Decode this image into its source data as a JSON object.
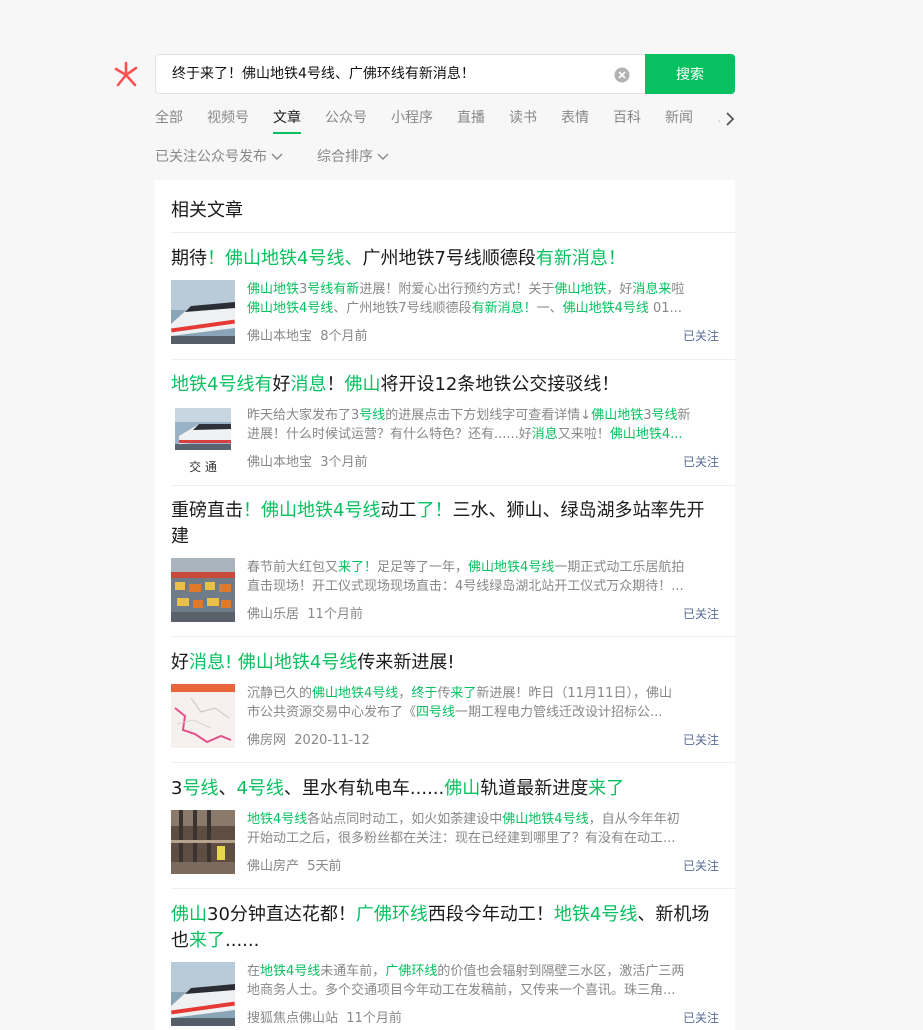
{
  "search": {
    "query": "终于来了！佛山地铁4号线、广佛环线有新消息！",
    "button": "搜索"
  },
  "tabs": [
    "全部",
    "视频号",
    "文章",
    "公众号",
    "小程序",
    "直播",
    "读书",
    "表情",
    "百科",
    "新闻",
    "…"
  ],
  "active_tab": "文章",
  "filters": {
    "source": "已关注公众号发布",
    "sort": "综合排序"
  },
  "section_title": "相关文章",
  "articles": [
    {
      "title": [
        [
          "期待",
          0
        ],
        [
          "！佛山地铁4号线",
          1
        ],
        [
          "、",
          1
        ],
        [
          "广州地铁7号线顺德段",
          0
        ],
        [
          "有新消息！",
          1
        ]
      ],
      "desc1": [
        [
          "佛山地铁",
          1
        ],
        [
          "3",
          0
        ],
        [
          "号线有新",
          1
        ],
        [
          "进展！附爱心出行预约方式！关于",
          0
        ],
        [
          "佛山地铁",
          1
        ],
        [
          "，好",
          0
        ],
        [
          "消息来",
          1
        ],
        [
          "啦",
          0
        ]
      ],
      "desc2": [
        [
          "佛山地铁4号线",
          1
        ],
        [
          "、广州地铁7号线顺德段",
          0
        ],
        [
          "有新消息！",
          1
        ],
        [
          "一、",
          0
        ],
        [
          "佛山地铁4号线",
          1
        ],
        [
          " 01...",
          0
        ]
      ],
      "source": "佛山本地宝",
      "time": "8个月前",
      "follow": "已关注"
    },
    {
      "title": [
        [
          "地铁4号线有",
          1
        ],
        [
          "好",
          0
        ],
        [
          "消息",
          1
        ],
        [
          "！",
          0
        ],
        [
          "佛山",
          1
        ],
        [
          "将开设12条地铁公交接驳线！",
          0
        ]
      ],
      "desc1": [
        [
          "昨天给大家发布了3",
          0
        ],
        [
          "号线",
          1
        ],
        [
          "的进展点击下方划线字可查看详情↓",
          0
        ],
        [
          "佛山地铁",
          1
        ],
        [
          "3",
          0
        ],
        [
          "号线",
          1
        ],
        [
          "新",
          0
        ]
      ],
      "desc2": [
        [
          "进展！什么时候试运营？有什么特色？还有......好",
          0
        ],
        [
          "消息",
          1
        ],
        [
          "又来啦！",
          0
        ],
        [
          "佛山地铁4...",
          1
        ]
      ],
      "source": "佛山本地宝",
      "time": "3个月前",
      "follow": "已关注",
      "thumb_caption": "交 通"
    },
    {
      "title": [
        [
          "重磅直击",
          0
        ],
        [
          "！佛山地铁4号线",
          1
        ],
        [
          "动工",
          0
        ],
        [
          "了！",
          1
        ],
        [
          "三水、狮山、绿岛湖多站率先开建",
          0
        ]
      ],
      "desc1": [
        [
          "春节前大红包又",
          0
        ],
        [
          "来了！",
          1
        ],
        [
          "足足等了一年，",
          0
        ],
        [
          "佛山地铁4号线",
          1
        ],
        [
          "一期正式动工乐居航拍",
          0
        ]
      ],
      "desc2": [
        [
          "直击现场！开工仪式现场现场直击：4号线绿岛湖北站开工仪式万众期待！...",
          0
        ]
      ],
      "source": "佛山乐居",
      "time": "11个月前",
      "follow": "已关注"
    },
    {
      "title": [
        [
          "好",
          0
        ],
        [
          "消息! 佛山地铁4号线",
          1
        ],
        [
          "传来新进展!",
          0
        ]
      ],
      "desc1": [
        [
          "沉静已久的",
          0
        ],
        [
          "佛山地铁4号线",
          1
        ],
        [
          "，",
          0
        ],
        [
          "终于",
          1
        ],
        [
          "传",
          0
        ],
        [
          "来了",
          1
        ],
        [
          "新进展！昨日（11月11日），佛山",
          0
        ]
      ],
      "desc2": [
        [
          "市公共资源交易中心发布了《",
          0
        ],
        [
          "四号线",
          1
        ],
        [
          "一期工程电力管线迁改设计招标公...",
          0
        ]
      ],
      "source": "佛房网",
      "time": "2020-11-12",
      "follow": "已关注"
    },
    {
      "title": [
        [
          "3",
          0
        ],
        [
          "号线",
          1
        ],
        [
          "、",
          0
        ],
        [
          "4号线",
          1
        ],
        [
          "、里水有轨电车......",
          0
        ],
        [
          "佛山",
          1
        ],
        [
          "轨道最新进度",
          0
        ],
        [
          "来了",
          1
        ]
      ],
      "desc1": [
        [
          "地铁4号线",
          1
        ],
        [
          "各站点同时动工，如火如荼建设中",
          0
        ],
        [
          "佛山地铁4号线",
          1
        ],
        [
          "，自从今年年初",
          0
        ]
      ],
      "desc2": [
        [
          "开始动工之后，很多粉丝都在关注：现在已经建到哪里了？有没有在动工...",
          0
        ]
      ],
      "source": "佛山房产",
      "time": "5天前",
      "follow": "已关注"
    },
    {
      "title": [
        [
          "佛山",
          1
        ],
        [
          "30分钟直达花都！",
          0
        ],
        [
          "广佛环线",
          1
        ],
        [
          "西段今年动工！",
          0
        ],
        [
          "地铁4号线",
          1
        ],
        [
          "、新机场也",
          0
        ],
        [
          "来了",
          1
        ],
        [
          "......",
          0
        ]
      ],
      "desc1": [
        [
          "在",
          0
        ],
        [
          "地铁4号线",
          1
        ],
        [
          "未通车前，",
          0
        ],
        [
          "广佛环线",
          1
        ],
        [
          "的价值也会辐射到隔壁三水区，激活广三两",
          0
        ]
      ],
      "desc2": [
        [
          "地商务人士。多个交通项目今年动工在发稿前，又传来一个喜讯。珠三角...",
          0
        ]
      ],
      "source": "搜狐焦点佛山站",
      "time": "11个月前",
      "follow": "已关注"
    }
  ],
  "colors": {
    "accent": "#07c160",
    "link": "#576b95",
    "muted": "#888888"
  }
}
